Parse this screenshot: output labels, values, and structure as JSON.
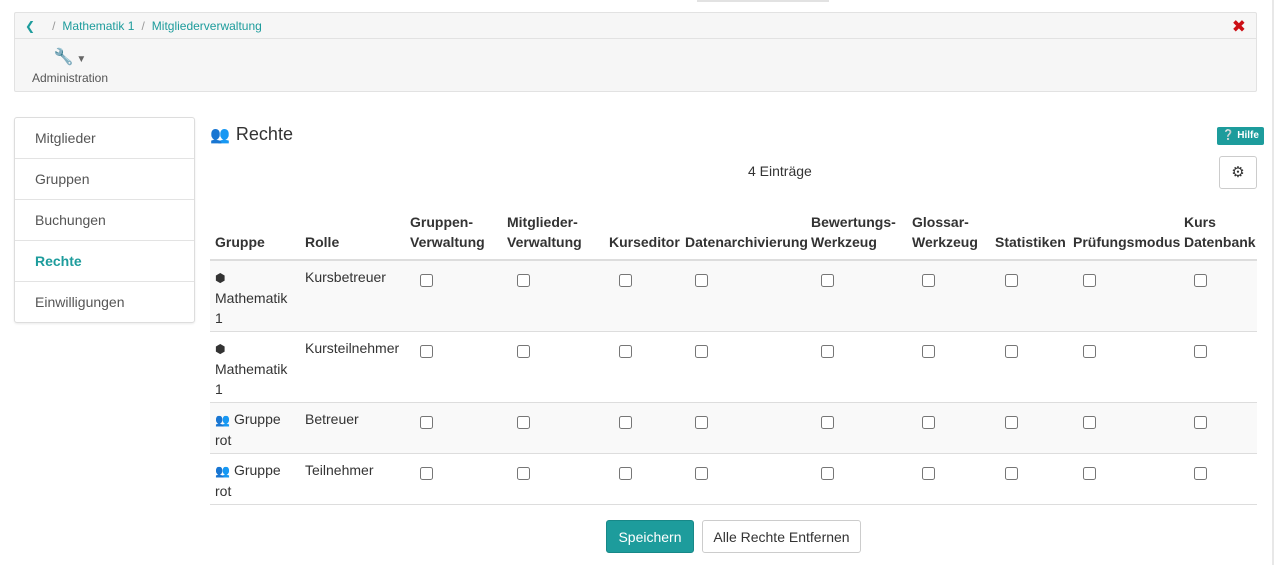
{
  "breadcrumb": {
    "back_icon": "chevron-left-icon",
    "items": [
      "Mathematik 1",
      "Mitgliederverwaltung"
    ]
  },
  "close_icon": "close-icon",
  "toolbar": {
    "admin_icon": "wrench-icon",
    "admin_label": "Administration"
  },
  "sidebar": {
    "items": [
      {
        "label": "Mitglieder"
      },
      {
        "label": "Gruppen"
      },
      {
        "label": "Buchungen"
      },
      {
        "label": "Rechte",
        "active": true
      },
      {
        "label": "Einwilligungen"
      }
    ]
  },
  "main": {
    "title": "Rechte",
    "title_icon": "users-icon",
    "help_label": "Hilfe",
    "entries_count": "4 Einträge",
    "settings_icon": "gear-icon"
  },
  "table": {
    "columns": [
      {
        "line1": "",
        "line2": "Gruppe"
      },
      {
        "line1": "",
        "line2": "Rolle"
      },
      {
        "line1": "Gruppen-",
        "line2": "Verwaltung"
      },
      {
        "line1": "Mitglieder-",
        "line2": "Verwaltung"
      },
      {
        "line1": "",
        "line2": "Kurseditor"
      },
      {
        "line1": "",
        "line2": "Datenarchivierung"
      },
      {
        "line1": "Bewertungs-",
        "line2": "Werkzeug"
      },
      {
        "line1": "Glossar-",
        "line2": "Werkzeug"
      },
      {
        "line1": "",
        "line2": "Statistiken"
      },
      {
        "line1": "",
        "line2": "Prüfungsmodus"
      },
      {
        "line1": "Kurs",
        "line2": "Datenbank"
      }
    ],
    "rows": [
      {
        "group_icon": "cube-icon",
        "group_l1": "",
        "group_l2": "Mathematik",
        "group_l3": "1",
        "role": "Kursbetreuer",
        "checks": [
          false,
          false,
          false,
          false,
          false,
          false,
          false,
          false,
          false
        ]
      },
      {
        "group_icon": "cube-icon",
        "group_l1": "",
        "group_l2": "Mathematik",
        "group_l3": "1",
        "role": "Kursteilnehmer",
        "checks": [
          false,
          false,
          false,
          false,
          false,
          false,
          false,
          false,
          false
        ]
      },
      {
        "group_icon": "users-icon",
        "group_l1": "Gruppe",
        "group_l2": "rot",
        "group_l3": "",
        "role": "Betreuer",
        "checks": [
          false,
          false,
          false,
          false,
          false,
          false,
          false,
          false,
          false
        ]
      },
      {
        "group_icon": "users-icon",
        "group_l1": "Gruppe",
        "group_l2": "rot",
        "group_l3": "",
        "role": "Teilnehmer",
        "checks": [
          false,
          false,
          false,
          false,
          false,
          false,
          false,
          false,
          false
        ]
      }
    ]
  },
  "actions": {
    "save_label": "Speichern",
    "clear_label": "Alle Rechte Entfernen"
  },
  "colors": {
    "accent": "#1d9c9c",
    "close": "#cc0f15"
  }
}
